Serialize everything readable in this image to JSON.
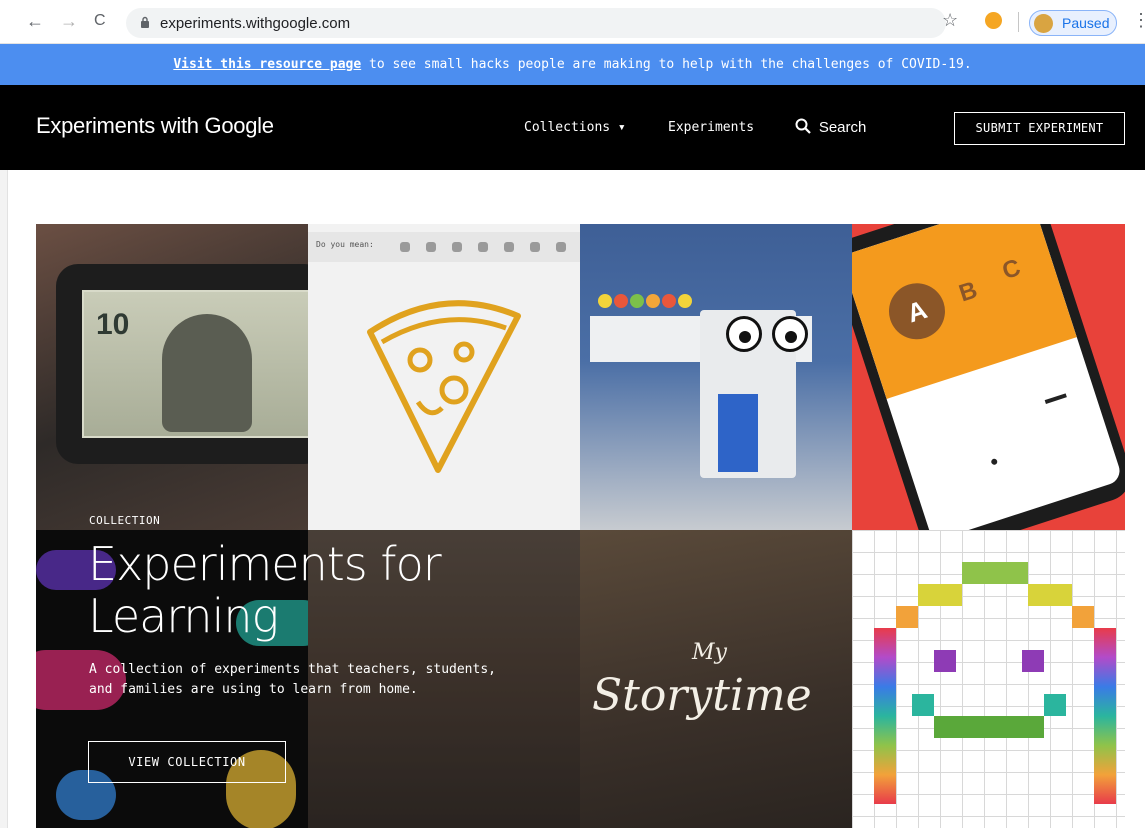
{
  "browser": {
    "back_icon": "←",
    "forward_icon": "→",
    "reload_icon": "C",
    "url": "experiments.withgoogle.com",
    "star_icon": "☆",
    "profile_status": "Paused",
    "menu_icon": "⋮"
  },
  "banner": {
    "link_text": "Visit this resource page",
    "rest_text": " to see small hacks people are making to help with the challenges of COVID-19.",
    "background": "#4c8ef0"
  },
  "header": {
    "logo": "Experiments with Google",
    "nav": {
      "collections": "Collections ▾",
      "experiments": "Experiments",
      "search": "Search"
    },
    "submit_button": "SUBMIT EXPERIMENT"
  },
  "tiles": {
    "autodraw_prompt": "Do you mean:",
    "storytime_my": "My",
    "storytime_word": "Storytime"
  },
  "collection": {
    "label": "COLLECTION",
    "title": "Experiments for Learning",
    "description": "A collection of experiments that teachers, students, and families are using to learn from home.",
    "button": "VIEW COLLECTION"
  }
}
